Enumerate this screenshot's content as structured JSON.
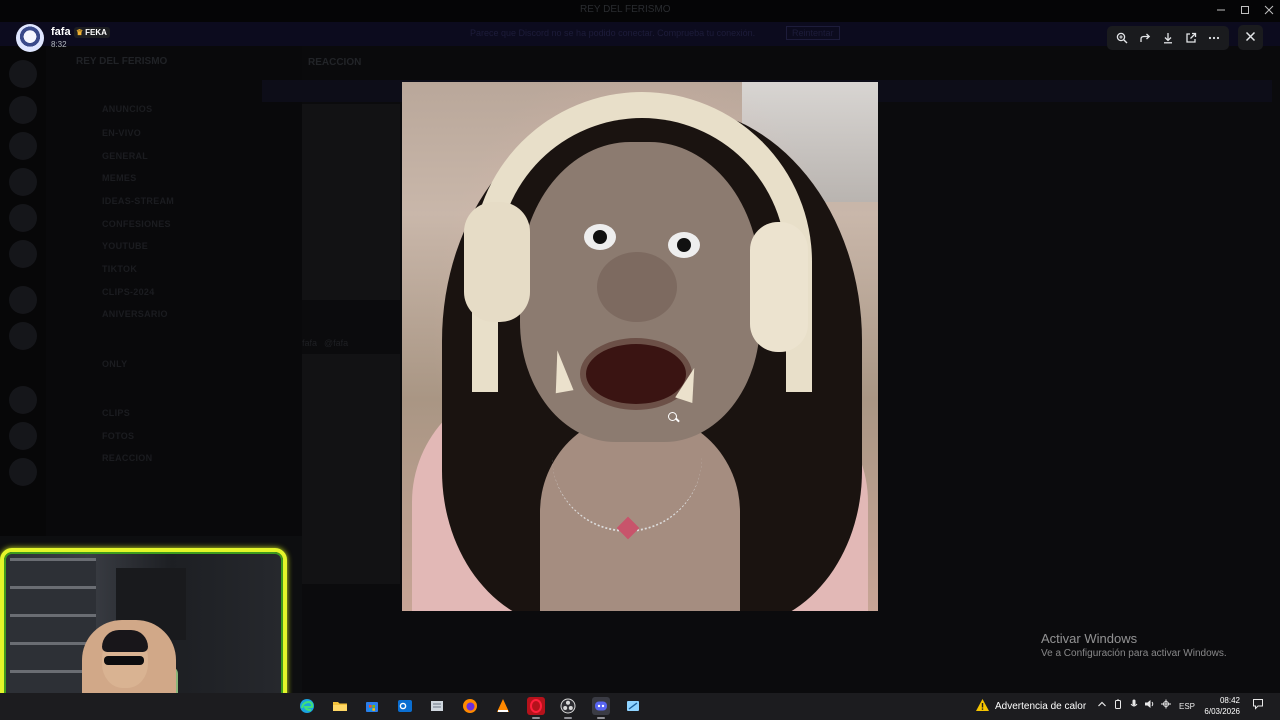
{
  "window": {
    "title": "REY DEL FERISMO"
  },
  "notice_bar": {
    "text": "Parece que Discord no se ha podido conectar. Comprueba tu conexión.",
    "action_label": "Reintentar"
  },
  "server": {
    "name": "REY DEL FERISMO",
    "channels": [
      "ANUNCIOS",
      "EN-VIVO",
      "GENERAL",
      "MEMES",
      "IDEAS-STREAM",
      "CONFESIONES",
      "YOUTUBE",
      "TIKTOK",
      "CLIPS-2024",
      "ANIVERSARIO",
      "ONLY",
      "CLIPS",
      "FOTOS",
      "REACCION"
    ]
  },
  "chat": {
    "channel_name": "REACCION",
    "author": "fafa",
    "handle": "@fafa"
  },
  "viewer": {
    "author_name": "fafa",
    "tag_label": "FEKA",
    "timestamp": "8:32",
    "toolbar": [
      {
        "icon": "zoom-in-icon"
      },
      {
        "icon": "forward-icon"
      },
      {
        "icon": "download-icon"
      },
      {
        "icon": "open-external-icon"
      },
      {
        "icon": "more-icon"
      }
    ],
    "close_icon": "close-icon"
  },
  "watermark": {
    "title": "Activar Windows",
    "subtitle": "Ve a Configuración para activar Windows."
  },
  "taskbar": {
    "apps": [
      "edge-icon",
      "file-explorer-icon",
      "store-icon",
      "outlook-icon",
      "notepad-icon",
      "firefox-icon",
      "vlc-icon",
      "opera-gx-icon",
      "obs-icon",
      "discord-icon",
      "snipping-icon"
    ],
    "warning_text": "Advertencia de calor",
    "language": "ESP",
    "time": "08:42",
    "date": "6/03/2026"
  },
  "colors": {
    "webcam_border": "#e3f52a",
    "discord_accent": "#5865f2",
    "warning": "#f5c400"
  }
}
